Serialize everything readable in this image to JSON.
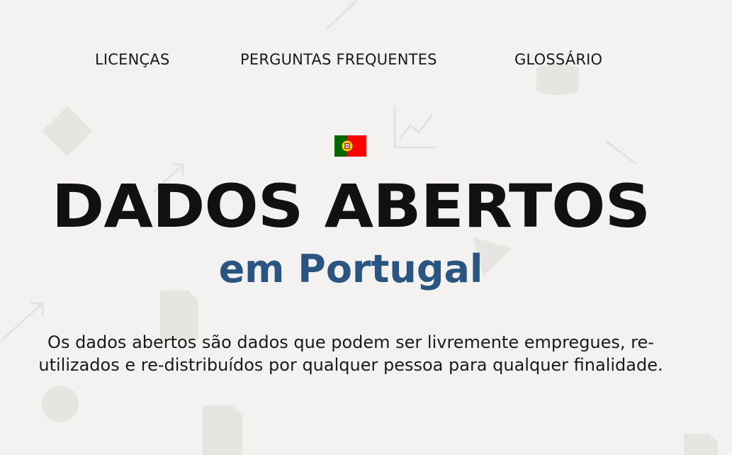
{
  "nav": {
    "items": [
      {
        "label": "LICENÇAS"
      },
      {
        "label": "PERGUNTAS FREQUENTES"
      },
      {
        "label": "GLOSSÁRIO"
      }
    ]
  },
  "hero": {
    "flag_icon": "portugal-flag-icon",
    "title": "DADOS ABERTOS",
    "subtitle": "em Portugal",
    "description": "Os dados abertos são dados que podem ser livremente empregues, re-utilizados e re-distribuídos por qualquer pessoa para qualquer finalidade."
  },
  "colors": {
    "background": "#f3f2f0",
    "title": "#111111",
    "subtitle": "#2a5580",
    "flag_green": "#006600",
    "flag_red": "#ff0000",
    "decor": "#e6e4e1"
  },
  "decorations": [
    "diamond-shape",
    "line-chart-icon",
    "database-icon",
    "arrow-icon",
    "document-icon",
    "circle-shape",
    "triangle-shape"
  ]
}
